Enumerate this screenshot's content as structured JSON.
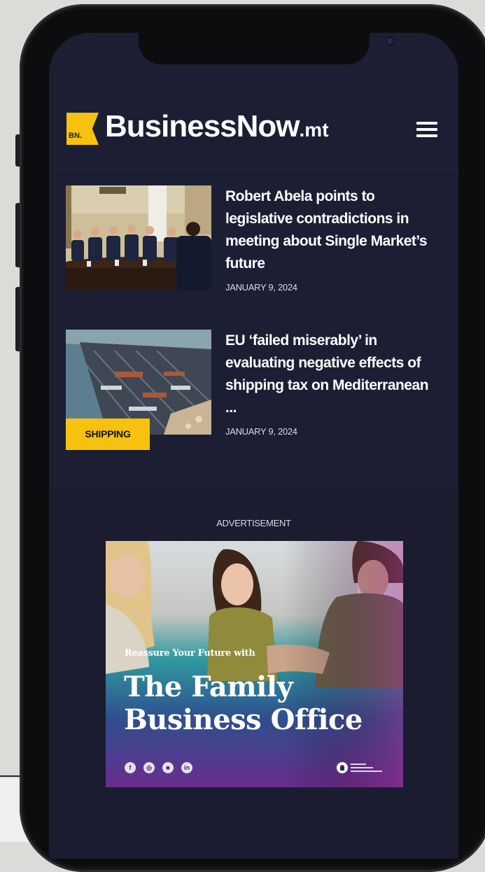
{
  "site": {
    "logo_badge": "BN.",
    "logo_name": "BusinessNow",
    "logo_tld": ".mt"
  },
  "articles": [
    {
      "title": "Robert Abela points to legislative contradictions in meeting about Single Market’s future",
      "date": "JANUARY 9, 2024",
      "category": ""
    },
    {
      "title": "EU ‘failed miserably’ in evaluating negative effects of shipping tax on Mediterranean ...",
      "date": "JANUARY 9, 2024",
      "category": "SHIPPING"
    }
  ],
  "advertisement": {
    "label": "ADVERTISEMENT",
    "tagline": "Reassure Your Future with",
    "headline": "The Family Business Office",
    "social": [
      "f",
      "◎",
      "■",
      "in"
    ]
  },
  "colors": {
    "accent": "#f6c20f",
    "background": "#1c1e33",
    "text": "#ffffff"
  },
  "icons": {
    "menu": "hamburger-menu-icon"
  }
}
